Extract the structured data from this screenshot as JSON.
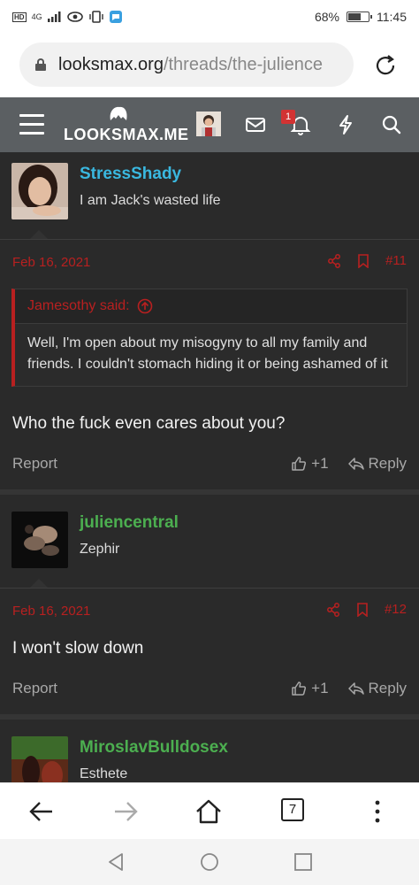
{
  "status_bar": {
    "network": "4G",
    "battery": "68%",
    "battery_level": 0.68,
    "time": "11:45"
  },
  "browser": {
    "url_domain": "looksmax.org",
    "url_path": "/threads/the-julience",
    "tab_count": "7"
  },
  "site": {
    "logo_text": "LOOKSMAX.ME",
    "notification_count": "1"
  },
  "colors": {
    "accent_red": "#b82020",
    "username_blue": "#3ab8e0",
    "username_green": "#4caf50",
    "header_bg": "#5b5f62"
  },
  "posts": [
    {
      "username": "StressShady",
      "user_title": "I am Jack's wasted life",
      "date": "Feb 16, 2021",
      "number": "#11",
      "quote": {
        "author": "Jamesothy said:",
        "text": "Well, I'm open about my misogyny to all my family and friends. I couldn't stomach hiding it or being ashamed of it"
      },
      "message": "Who the fuck even cares about you?",
      "report_label": "Report",
      "like_count": "+1",
      "reply_label": "Reply"
    },
    {
      "username": "juliencentral",
      "user_title": "Zephir",
      "date": "Feb 16, 2021",
      "number": "#12",
      "message": "I won't slow down",
      "report_label": "Report",
      "like_count": "+1",
      "reply_label": "Reply"
    },
    {
      "username": "MiroslavBulldosex",
      "user_title": "Esthete"
    }
  ],
  "icons": {
    "share": "share-icon",
    "bookmark": "bookmark-icon",
    "like": "thumbs-up-icon",
    "reply": "reply-arrow-icon",
    "quote_up": "arrow-up-circle-icon"
  }
}
